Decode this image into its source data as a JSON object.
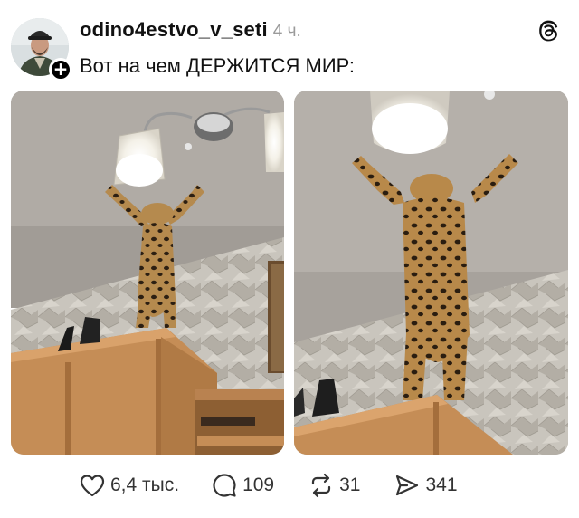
{
  "post": {
    "username": "odino4estvo_v_seti",
    "timestamp": "4 ч.",
    "caption": "Вот на чем ДЕРЖИТСЯ МИР:",
    "follow_symbol": "+"
  },
  "icons": {
    "app_logo": "threads-logo-icon",
    "like": "heart-icon",
    "reply": "speech-bubble-icon",
    "repost": "repost-arrows-icon",
    "share": "paper-plane-icon"
  },
  "actions": {
    "likes": "6,4 тыс.",
    "replies": "109",
    "reposts": "31",
    "shares": "341"
  },
  "colors": {
    "text": "#111111",
    "muted": "#9a9a9a",
    "icon": "#333333"
  }
}
